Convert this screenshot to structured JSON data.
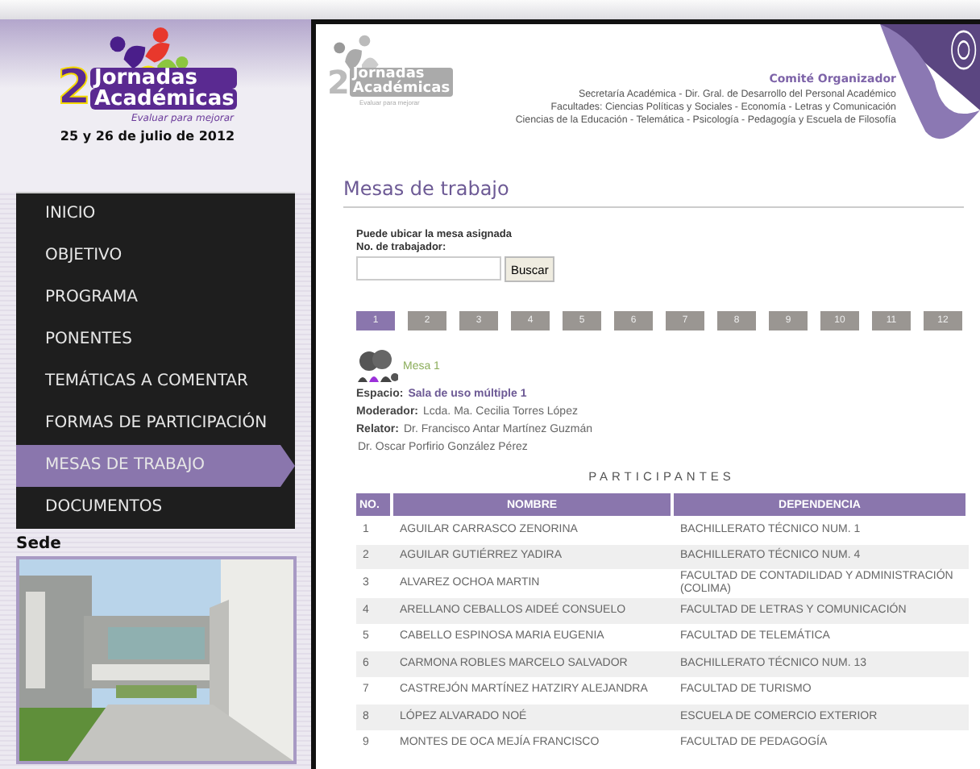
{
  "sidebar": {
    "logo": {
      "number": "2",
      "line1": "Jornadas",
      "line2": "Académicas",
      "tagline": "Evaluar para mejorar"
    },
    "date": "25 y 26 de julio de 2012",
    "nav": [
      {
        "label": "INICIO",
        "selected": false
      },
      {
        "label": "OBJETIVO",
        "selected": false
      },
      {
        "label": "PROGRAMA",
        "selected": false
      },
      {
        "label": "PONENTES",
        "selected": false
      },
      {
        "label": "TEMÁTICAS A COMENTAR",
        "selected": false
      },
      {
        "label": "FORMAS DE PARTICIPACIÓN",
        "selected": false
      },
      {
        "label": "MESAS DE TRABAJO",
        "selected": true
      },
      {
        "label": "DOCUMENTOS",
        "selected": false
      }
    ],
    "venue": {
      "title": "Sede"
    }
  },
  "header": {
    "logo": {
      "number": "2",
      "line1": "Jornadas",
      "line2": "Académicas",
      "tagline": "Evaluar para mejorar"
    },
    "committee_title": "Comité Organizador",
    "committee_lines": [
      "Secretaría Académica - Dir. Gral. de Desarrollo del Personal Académico",
      "Facultades: Ciencias Políticas y Sociales - Economía - Letras y Comunicación",
      "Ciencias de la Educación - Telemática - Psicología - Pedagogía y  Escuela de Filosofía"
    ]
  },
  "page_title": "Mesas de trabajo",
  "search": {
    "hint": "Puede ubicar la mesa asignada",
    "label": "No. de trabajador:",
    "button": "Buscar"
  },
  "pages": [
    {
      "label": "1",
      "selected": true
    },
    {
      "label": "2",
      "selected": false
    },
    {
      "label": "3",
      "selected": false
    },
    {
      "label": "4",
      "selected": false
    },
    {
      "label": "5",
      "selected": false
    },
    {
      "label": "6",
      "selected": false
    },
    {
      "label": "7",
      "selected": false
    },
    {
      "label": "8",
      "selected": false
    },
    {
      "label": "9",
      "selected": false
    },
    {
      "label": "10",
      "selected": false
    },
    {
      "label": "11",
      "selected": false
    },
    {
      "label": "12",
      "selected": false
    }
  ],
  "table_group": {
    "name": "Mesa 1",
    "details": [
      {
        "label": "Espacio:",
        "value": "Sala de uso múltiple 1",
        "kind": "link"
      },
      {
        "label": "Moderador:",
        "value": "Lcda. Ma. Cecilia Torres López",
        "kind": "plain"
      },
      {
        "label": "Relator:",
        "value": "Dr. Francisco Antar Martínez Guzmán",
        "kind": "plain"
      }
    ],
    "extra_line": "Dr. Oscar Porfirio González Pérez"
  },
  "participants": {
    "title": "PARTICIPANTES",
    "columns": [
      "NO.",
      "NOMBRE",
      "DEPENDENCIA"
    ],
    "rows": [
      [
        "1",
        "AGUILAR CARRASCO ZENORINA",
        "BACHILLERATO TÉCNICO NUM. 1"
      ],
      [
        "2",
        "AGUILAR GUTIÉRREZ YADIRA",
        "BACHILLERATO TÉCNICO NUM. 4"
      ],
      [
        "3",
        "ALVAREZ OCHOA MARTIN",
        "FACULTAD DE CONTADILIDAD Y ADMINISTRACIÓN (COLIMA)"
      ],
      [
        "4",
        "ARELLANO CEBALLOS AIDEÉ CONSUELO",
        "FACULTAD DE LETRAS Y COMUNICACIÓN"
      ],
      [
        "5",
        "CABELLO ESPINOSA MARIA EUGENIA",
        "FACULTAD DE TELEMÁTICA"
      ],
      [
        "6",
        "CARMONA ROBLES MARCELO SALVADOR",
        "BACHILLERATO TÉCNICO NUM. 13"
      ],
      [
        "7",
        "CASTREJÓN MARTÍNEZ HATZIRY ALEJANDRA",
        "FACULTAD DE TURISMO"
      ],
      [
        "8",
        "LÓPEZ ALVARADO NOÉ",
        "ESCUELA DE COMERCIO EXTERIOR"
      ],
      [
        "9",
        "MONTES DE OCA MEJÍA FRANCISCO",
        "FACULTAD DE PEDAGOGÍA"
      ]
    ]
  }
}
